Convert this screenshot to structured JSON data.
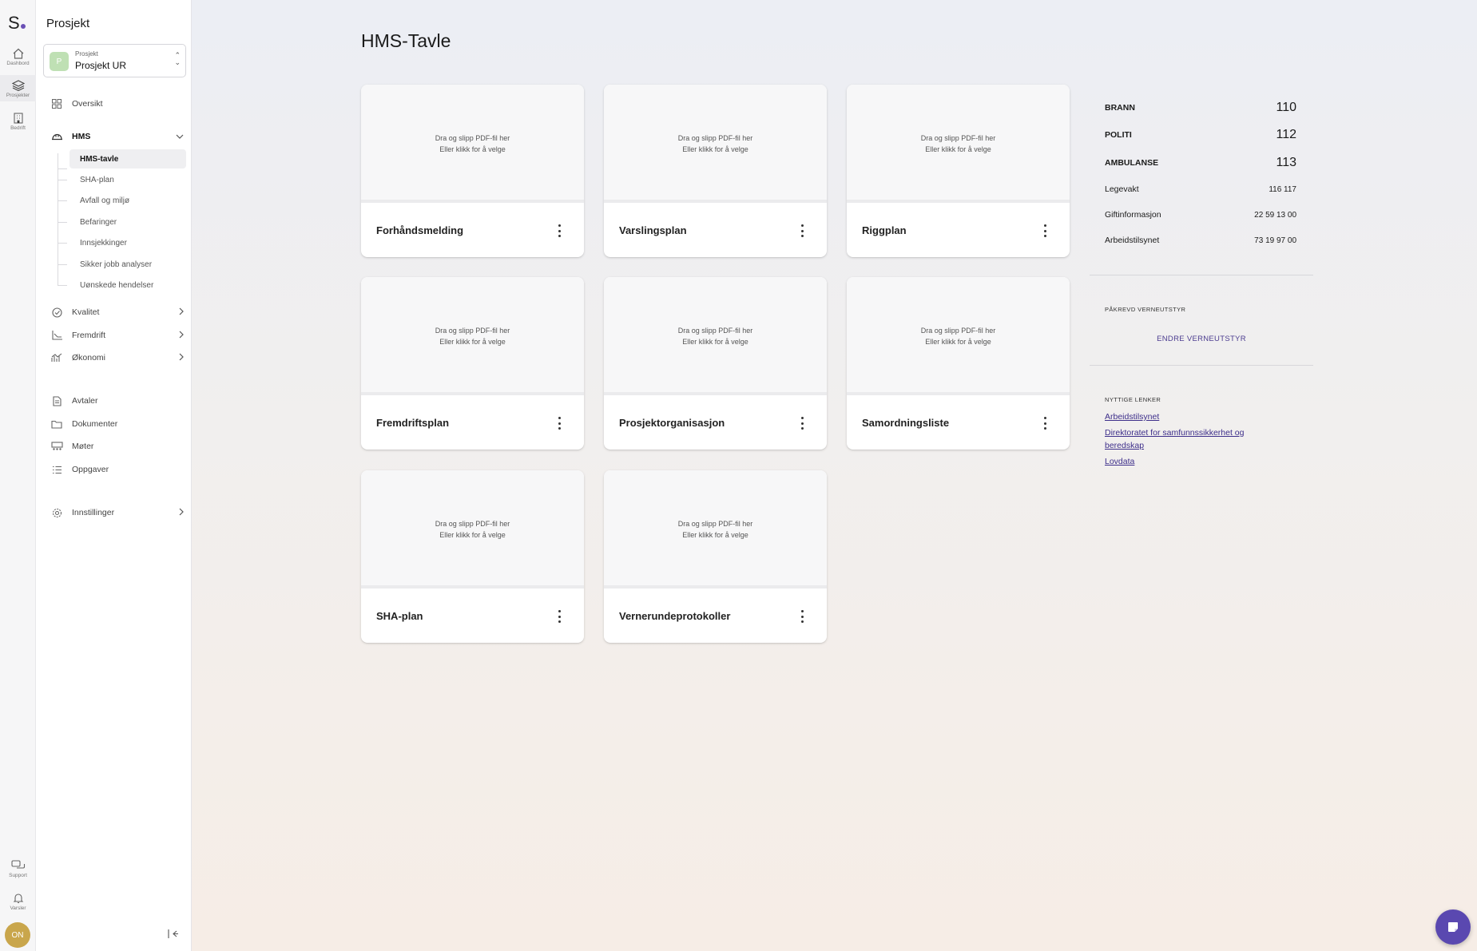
{
  "rail": {
    "logo": "S",
    "items": [
      {
        "label": "Dashbord",
        "icon": "home-icon"
      },
      {
        "label": "Prosjekter",
        "icon": "layers-icon"
      },
      {
        "label": "Bedrift",
        "icon": "building-icon"
      }
    ],
    "support_label": "Support",
    "notifications_label": "Varsler",
    "avatar_initials": "ON"
  },
  "sidebar": {
    "title": "Prosjekt",
    "project_select": {
      "caption": "Prosjekt",
      "value": "Prosjekt UR",
      "badge": "P"
    },
    "overview": "Oversikt",
    "hms": {
      "label": "HMS",
      "sub_items": [
        "HMS-tavle",
        "SHA-plan",
        "Avfall og miljø",
        "Befaringer",
        "Innsjekkinger",
        "Sikker jobb analyser",
        "Uønskede hendelser"
      ],
      "active": "HMS-tavle"
    },
    "kvalitet": "Kvalitet",
    "fremdrift": "Fremdrift",
    "okonomi": "Økonomi",
    "avtaler": "Avtaler",
    "dokumenter": "Dokumenter",
    "moter": "Møter",
    "oppgaver": "Oppgaver",
    "innstillinger": "Innstillinger"
  },
  "main": {
    "title": "HMS-Tavle",
    "drop_line1": "Dra og slipp PDF-fil her",
    "drop_line2": "Eller klikk for å velge",
    "cards": [
      "Forhåndsmelding",
      "Varslingsplan",
      "Riggplan",
      "Fremdriftsplan",
      "Prosjektorganisasjon",
      "Samordningsliste",
      "SHA-plan",
      "Vernerundeprotokoller"
    ]
  },
  "emergency": {
    "brann": {
      "label": "BRANN",
      "number": "110"
    },
    "politi": {
      "label": "POLITI",
      "number": "112"
    },
    "ambulanse": {
      "label": "AMBULANSE",
      "number": "113"
    },
    "legevakt": {
      "label": "Legevakt",
      "number": "116 117"
    },
    "giftinformasjon": {
      "label": "Giftinformasjon",
      "number": "22 59 13 00"
    },
    "arbeidstilsynet": {
      "label": "Arbeidstilsynet",
      "number": "73 19 97 00"
    }
  },
  "equipment": {
    "caption": "PÅKREVD VERNEUTSTYR",
    "button": "ENDRE VERNEUTSTYR"
  },
  "links": {
    "caption": "NYTTIGE LENKER",
    "items": [
      "Arbeidstilsynet",
      "Direktoratet for samfunnssikkerhet og beredskap",
      "Lovdata"
    ]
  },
  "colors": {
    "accent": "#5a48b0",
    "link": "#3d2e8a",
    "project_badge": "#bfe0b4"
  }
}
